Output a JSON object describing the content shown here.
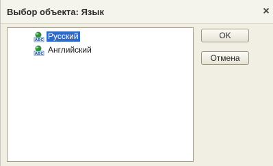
{
  "window": {
    "title": "Выбор объекта: Язык",
    "close_glyph": "×"
  },
  "list": {
    "items": [
      {
        "label": "Русский",
        "icon": "language-abc-icon",
        "selected": true
      },
      {
        "label": "Английский",
        "icon": "language-abc-icon",
        "selected": false
      }
    ]
  },
  "buttons": {
    "ok_label": "OK",
    "cancel_label": "Отмена"
  },
  "colors": {
    "selection": "#316ac5",
    "window_bg": "#f1efe4"
  }
}
